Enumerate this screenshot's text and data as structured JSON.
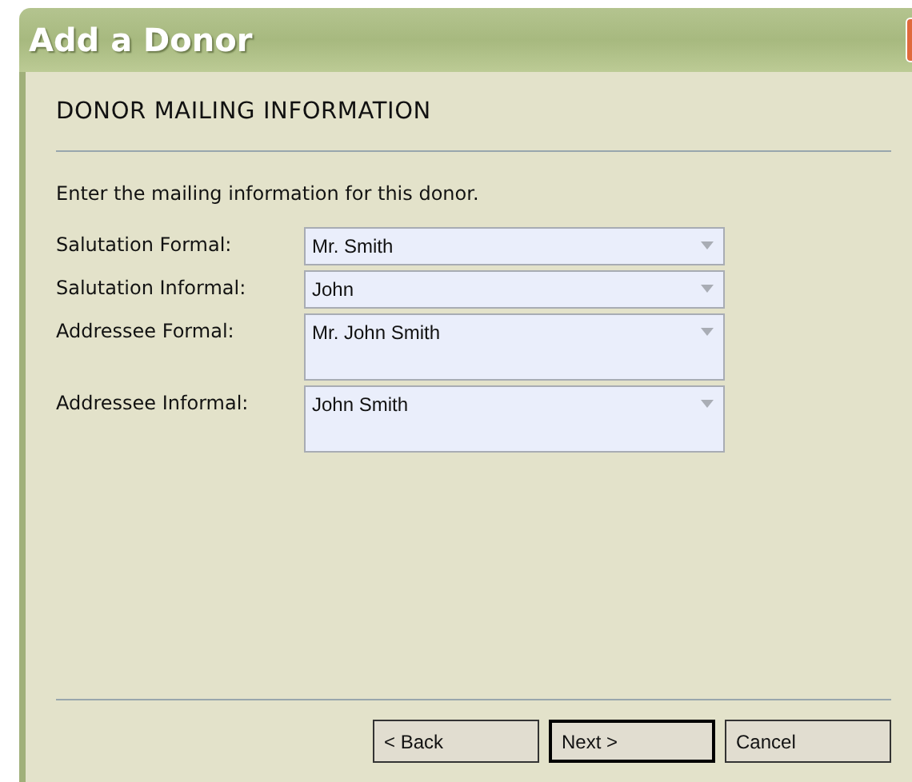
{
  "window": {
    "title": "Add a Donor"
  },
  "heading": "DONOR MAILING INFORMATION",
  "instructions": "Enter the mailing information for this donor.",
  "fields": [
    {
      "label": "Salutation Formal:",
      "value": "Mr. Smith",
      "kind": "single"
    },
    {
      "label": "Salutation Informal:",
      "value": "John",
      "kind": "single"
    },
    {
      "label": "Addressee Formal:",
      "value": "Mr. John Smith",
      "kind": "multi"
    },
    {
      "label": "Addressee Informal:",
      "value": "John Smith",
      "kind": "multi"
    }
  ],
  "buttons": [
    {
      "label": "< Back",
      "default": false
    },
    {
      "label": "Next >",
      "default": true
    },
    {
      "label": "Cancel",
      "default": false
    }
  ]
}
